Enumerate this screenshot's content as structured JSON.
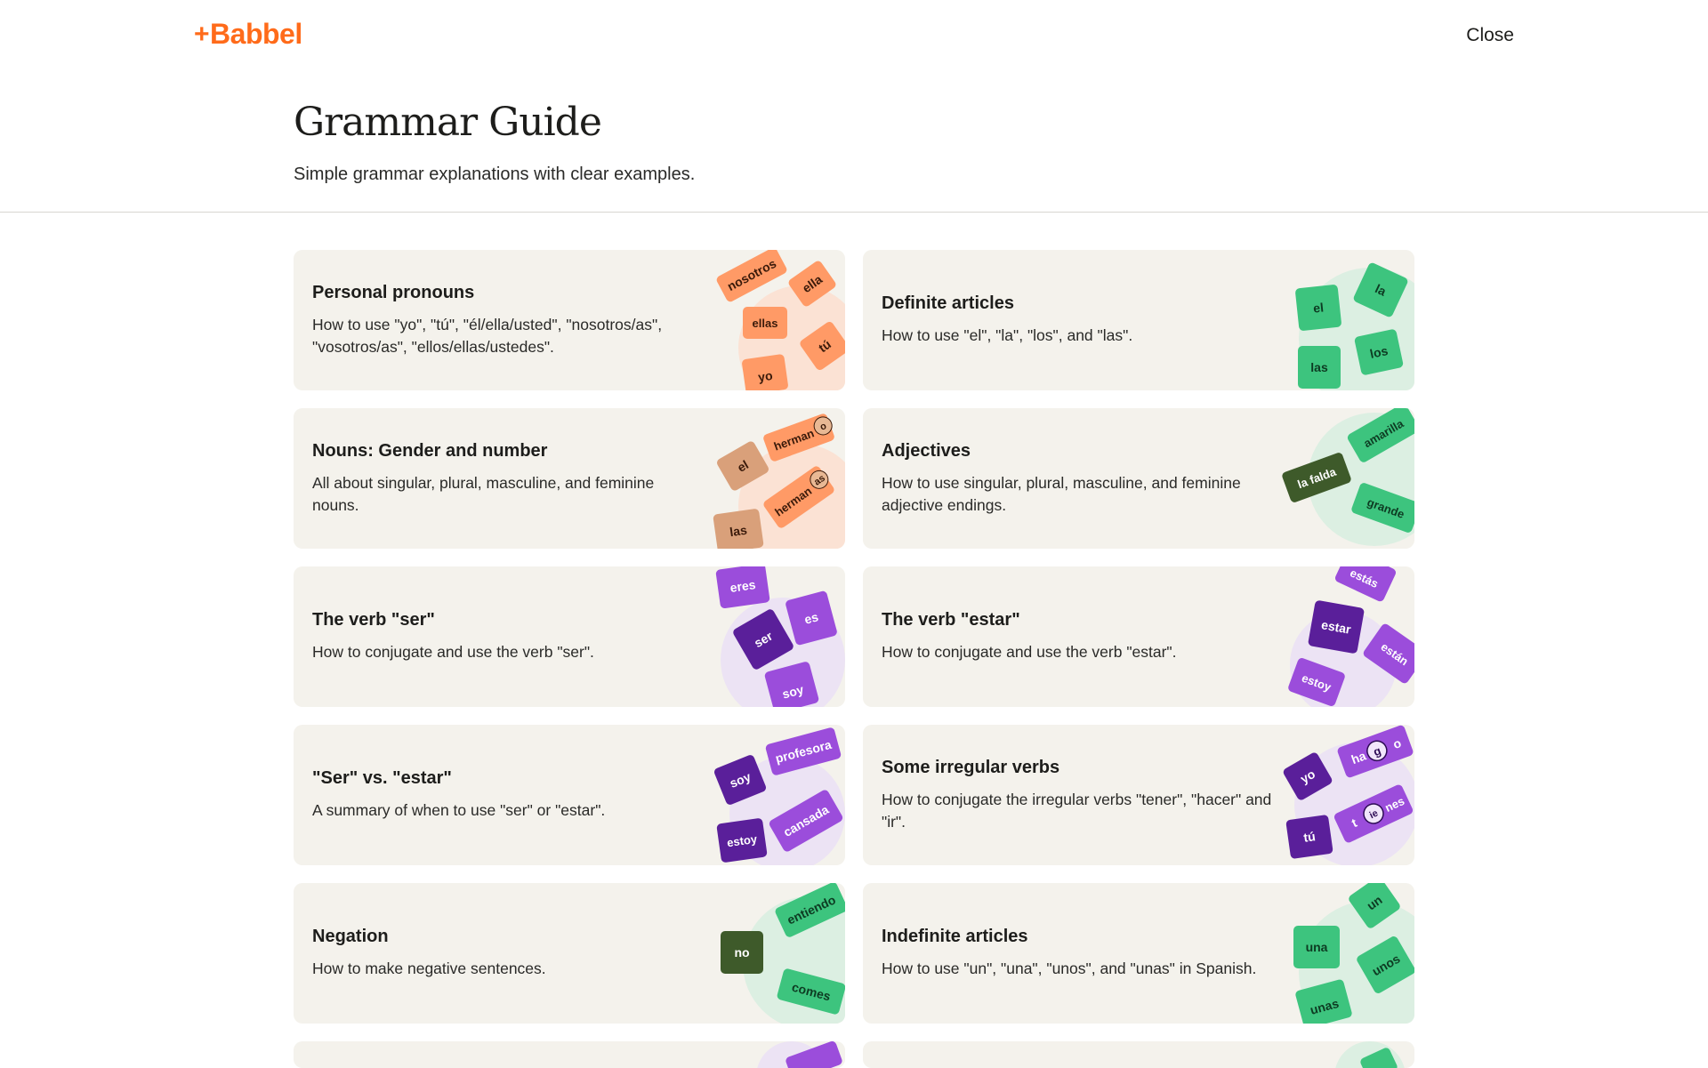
{
  "header": {
    "logo_plus": "+",
    "logo_text": "Babbel",
    "close_label": "Close",
    "brand_color": "#ff6b1a"
  },
  "hero": {
    "title": "Grammar Guide",
    "subtitle": "Simple grammar explanations with clear examples."
  },
  "cards": [
    {
      "title": "Personal pronouns",
      "description": "How to use \"yo\", \"tú\", \"él/ella/usted\", \"nosotros/as\", \"vosotros/as\", \"ellos/ellas/ustedes\".",
      "tiles": [
        "nosotros",
        "ella",
        "ellas",
        "tú",
        "yo"
      ],
      "accent": "#ff9a66"
    },
    {
      "title": "Definite articles",
      "description": "How to use \"el\", \"la\", \"los\", and \"las\".",
      "tiles": [
        "el",
        "la",
        "los",
        "las"
      ],
      "accent": "#3dc47e"
    },
    {
      "title": "Nouns: Gender and number",
      "description": "All about singular, plural, masculine, and feminine nouns.",
      "tiles": [
        "el",
        "herman",
        "o",
        "herman",
        "as",
        "las"
      ],
      "accent": "#ff9a66"
    },
    {
      "title": "Adjectives",
      "description": "How to use singular, plural, masculine, and feminine adjective endings.",
      "tiles": [
        "la falda",
        "amarilla",
        "grande"
      ],
      "accent": "#3dc47e"
    },
    {
      "title": "The verb \"ser\"",
      "description": "How to conjugate and use the verb \"ser\".",
      "tiles": [
        "eres",
        "es",
        "ser",
        "soy"
      ],
      "accent": "#9b4ddb"
    },
    {
      "title": "The verb \"estar\"",
      "description": "How to conjugate and use the verb \"estar\".",
      "tiles": [
        "estás",
        "estar",
        "están",
        "estoy"
      ],
      "accent": "#9b4ddb"
    },
    {
      "title": "\"Ser\" vs. \"estar\"",
      "description": "A summary of when to use \"ser\" or \"estar\".",
      "tiles": [
        "soy",
        "profesora",
        "estoy",
        "cansada"
      ],
      "accent": "#9b4ddb"
    },
    {
      "title": "Some irregular verbs",
      "description": "How to conjugate the irregular verbs \"tener\", \"hacer\" and \"ir\".",
      "tiles": [
        "yo",
        "ha",
        "g",
        "o",
        "tú",
        "t",
        "ie",
        "nes"
      ],
      "accent": "#9b4ddb"
    },
    {
      "title": "Negation",
      "description": "How to make negative sentences.",
      "tiles": [
        "no",
        "entiendo",
        "comes"
      ],
      "accent": "#3dc47e"
    },
    {
      "title": "Indefinite articles",
      "description": "How to use \"un\", \"una\", \"unos\", and \"unas\" in Spanish.",
      "tiles": [
        "un",
        "una",
        "unos",
        "unas"
      ],
      "accent": "#3dc47e"
    }
  ]
}
